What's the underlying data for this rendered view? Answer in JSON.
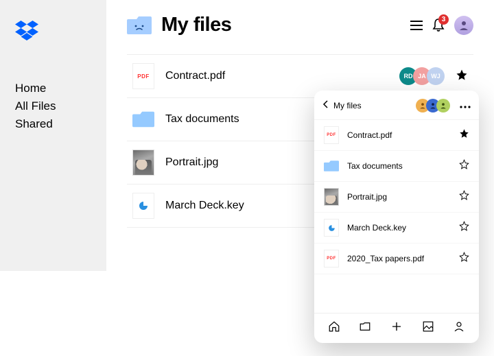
{
  "sidebar": {
    "items": [
      {
        "label": "Home"
      },
      {
        "label": "All Files"
      },
      {
        "label": "Shared"
      }
    ]
  },
  "header": {
    "title": "My files",
    "notification_count": "3"
  },
  "files": [
    {
      "name": "Contract.pdf",
      "type": "pdf",
      "starred": true,
      "shared": [
        {
          "initials": "RD",
          "color": "#0d8a8a"
        },
        {
          "initials": "JA",
          "color": "#f2a0a0"
        },
        {
          "initials": "WJ",
          "color": "#c0d2f0"
        }
      ]
    },
    {
      "name": "Tax documents",
      "type": "folder",
      "starred": false,
      "shared": []
    },
    {
      "name": "Portrait.jpg",
      "type": "image",
      "starred": false,
      "shared": []
    },
    {
      "name": "March Deck.key",
      "type": "key",
      "starred": false,
      "shared": []
    }
  ],
  "mobile": {
    "breadcrumb": "My files",
    "shared_with": [
      {
        "color": "#f0b050"
      },
      {
        "color": "#3a6ad0"
      },
      {
        "color": "#b0d060"
      }
    ],
    "files": [
      {
        "name": "Contract.pdf",
        "type": "pdf",
        "starred": true
      },
      {
        "name": "Tax documents",
        "type": "folder",
        "starred": false
      },
      {
        "name": "Portrait.jpg",
        "type": "image",
        "starred": false
      },
      {
        "name": "March Deck.key",
        "type": "key",
        "starred": false
      },
      {
        "name": "2020_Tax papers.pdf",
        "type": "pdf",
        "starred": false
      }
    ]
  },
  "icons": {
    "pdf_label": "PDF"
  }
}
